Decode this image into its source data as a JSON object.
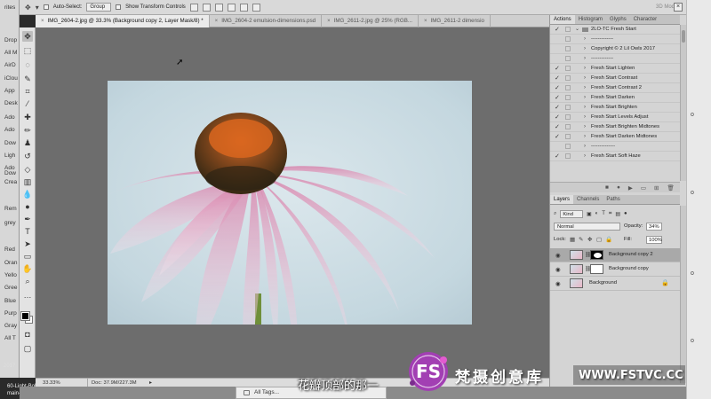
{
  "left_sidebar": {
    "items": [
      "rites",
      "Drop",
      "All M",
      "AirD",
      "iClou",
      "App",
      "Desk",
      "Ado",
      "Ado",
      "Dow",
      "Ligh",
      "Ado",
      "Dow",
      "Crea",
      "Rem",
      "grey",
      "Red",
      "Oran",
      "Yello",
      "Gree",
      "Blue",
      "Purp",
      "Gray",
      "All T"
    ],
    "bottom_items": [
      "2017",
      "60-Light-Bokeh-",
      "main-image.jpg"
    ]
  },
  "options_bar": {
    "auto_select_label": "Auto-Select:",
    "auto_select_value": "Group",
    "show_transform_label": "Show Transform Controls",
    "mode_3d_label": "3D Mode:"
  },
  "tabs": [
    {
      "label": "IMG_2604-2.jpg @ 33.3% (Background copy 2, Layer Mask/8) *",
      "active": true
    },
    {
      "label": "IMG_2604-2 emulsion-dimensions.psd",
      "active": false
    },
    {
      "label": "IMG_2611-2.jpg @ 25% (RGB...",
      "active": false
    },
    {
      "label": "IMG_2611-2 dimensio",
      "active": false
    }
  ],
  "status": {
    "zoom": "33.33%",
    "doc": "Doc: 37.9M/227.3M"
  },
  "actions_panel": {
    "tabs": [
      "Actions",
      "Histogram",
      "Glyphs",
      "Character"
    ],
    "rows": [
      {
        "label": "2LO-TC Fresh Start",
        "checked": true,
        "set": true
      },
      {
        "label": "-------------",
        "checked": false,
        "set": false
      },
      {
        "label": "Copyright © 2 Lil Owls 2017",
        "checked": false,
        "set": false
      },
      {
        "label": "-------------",
        "checked": false,
        "set": false
      },
      {
        "label": "Fresh Start Lighten",
        "checked": true,
        "set": false
      },
      {
        "label": "Fresh Start Contrast",
        "checked": true,
        "set": false
      },
      {
        "label": "Fresh Start Contrast 2",
        "checked": true,
        "set": false
      },
      {
        "label": "Fresh Start Darken",
        "checked": true,
        "set": false
      },
      {
        "label": "Fresh Start Brighten",
        "checked": true,
        "set": false
      },
      {
        "label": "Fresh Start Levels Adjust",
        "checked": true,
        "set": false
      },
      {
        "label": "Fresh Start Brighten Midtones",
        "checked": true,
        "set": false
      },
      {
        "label": "Fresh Start Darken Midtones",
        "checked": true,
        "set": false
      },
      {
        "label": "--------------",
        "checked": false,
        "set": false
      },
      {
        "label": "Fresh Start Soft Haze",
        "checked": true,
        "set": false
      }
    ]
  },
  "layers_panel": {
    "tabs": [
      "Layers",
      "Channels",
      "Paths"
    ],
    "filter_kind": "Kind",
    "blend_mode": "Normal",
    "opacity_label": "Opacity:",
    "opacity_value": "34%",
    "lock_label": "Lock:",
    "fill_label": "Fill:",
    "fill_value": "100%",
    "layers": [
      {
        "name": "Background copy 2",
        "selected": true,
        "has_mask": true
      },
      {
        "name": "Background copy",
        "selected": false,
        "has_mask": true
      },
      {
        "name": "Background",
        "selected": false,
        "has_mask": false
      }
    ]
  },
  "finder_bottom": {
    "all_tags": "All Tags..."
  },
  "subtitle": "花瓣顶部的那一",
  "watermark": {
    "brand_cn": "梵摄创意库",
    "url": "WWW.FSTVC.CC",
    "logo_text": "FS"
  },
  "colors": {
    "canvas_bg": "#6d6d6d",
    "panel_bg": "#d4d4d4",
    "selected_layer": "#a9a9a9",
    "logo_purple": "#a23fb3"
  }
}
